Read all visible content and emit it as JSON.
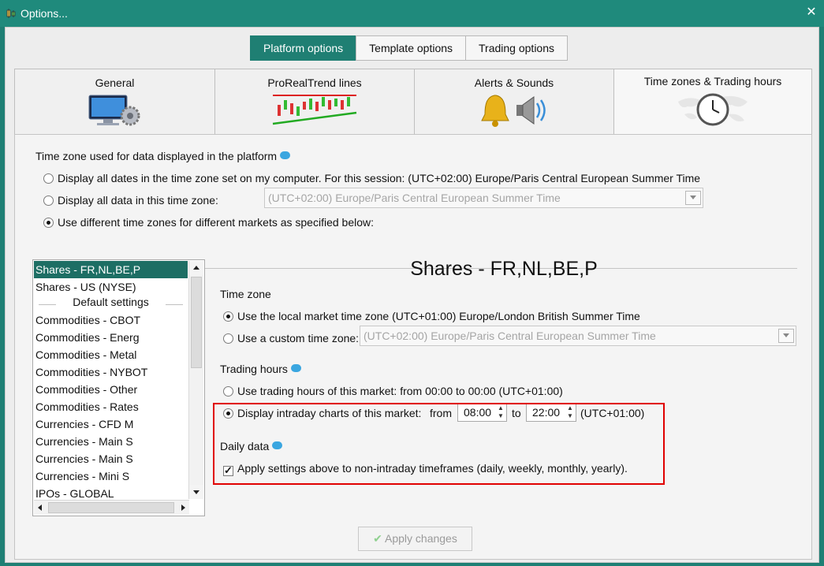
{
  "window": {
    "title": "Options..."
  },
  "top_tabs": [
    "Platform options",
    "Template options",
    "Trading options"
  ],
  "category_tabs": [
    {
      "label": "General",
      "icon": "monitor-gear-icon"
    },
    {
      "label": "ProRealTrend lines",
      "icon": "trendline-chart-icon"
    },
    {
      "label": "Alerts & Sounds",
      "icon": "bell-speaker-icon"
    },
    {
      "label": "Time zones & Trading hours",
      "icon": "clock-world-icon"
    }
  ],
  "tz_section": {
    "heading": "Time zone used for data displayed in the platform",
    "option1": "Display all dates in the time zone set on my computer. For this session:  (UTC+02:00) Europe/Paris Central European Summer Time",
    "option2": "Display all data in this time zone:",
    "option2_combo": "(UTC+02:00) Europe/Paris Central European Summer Time",
    "option3": "Use different time zones for different markets as specified below:"
  },
  "markets": [
    "Shares - FR,NL,BE,P",
    "Shares - US (NYSE)",
    "Default settings",
    "Commodities - CBOT",
    "Commodities - Energ",
    "Commodities - Metal",
    "Commodities - NYBOT",
    "Commodities - Other",
    "Commodities - Rates",
    "Currencies - CFD M",
    "Currencies - Main S",
    "Currencies - Main S",
    "Currencies - Mini S",
    "IPOs - GLOBAL"
  ],
  "detail": {
    "title": "Shares - FR,NL,BE,P",
    "timezone_heading": "Time zone",
    "local_tz": "Use the local market time zone (UTC+01:00) Europe/London British Summer Time",
    "custom_tz": "Use a custom time zone:",
    "custom_tz_combo": "(UTC+02:00) Europe/Paris Central European Summer Time",
    "trading_heading": "Trading hours",
    "use_trading_hours": "Use trading hours of this market: from 00:00 to 00:00  (UTC+01:00)",
    "display_intraday": "Display intraday charts of this market:",
    "from_label": "from",
    "from_time": "08:00",
    "to_label": "to",
    "to_time": "22:00",
    "tz_suffix": "(UTC+01:00)",
    "daily_heading": "Daily data",
    "apply_nonintraday": "Apply settings above to non-intraday timeframes (daily, weekly, monthly, yearly)."
  },
  "apply_button": "Apply changes",
  "colors": {
    "accent": "#1f7f73",
    "highlight": "#e00000"
  }
}
